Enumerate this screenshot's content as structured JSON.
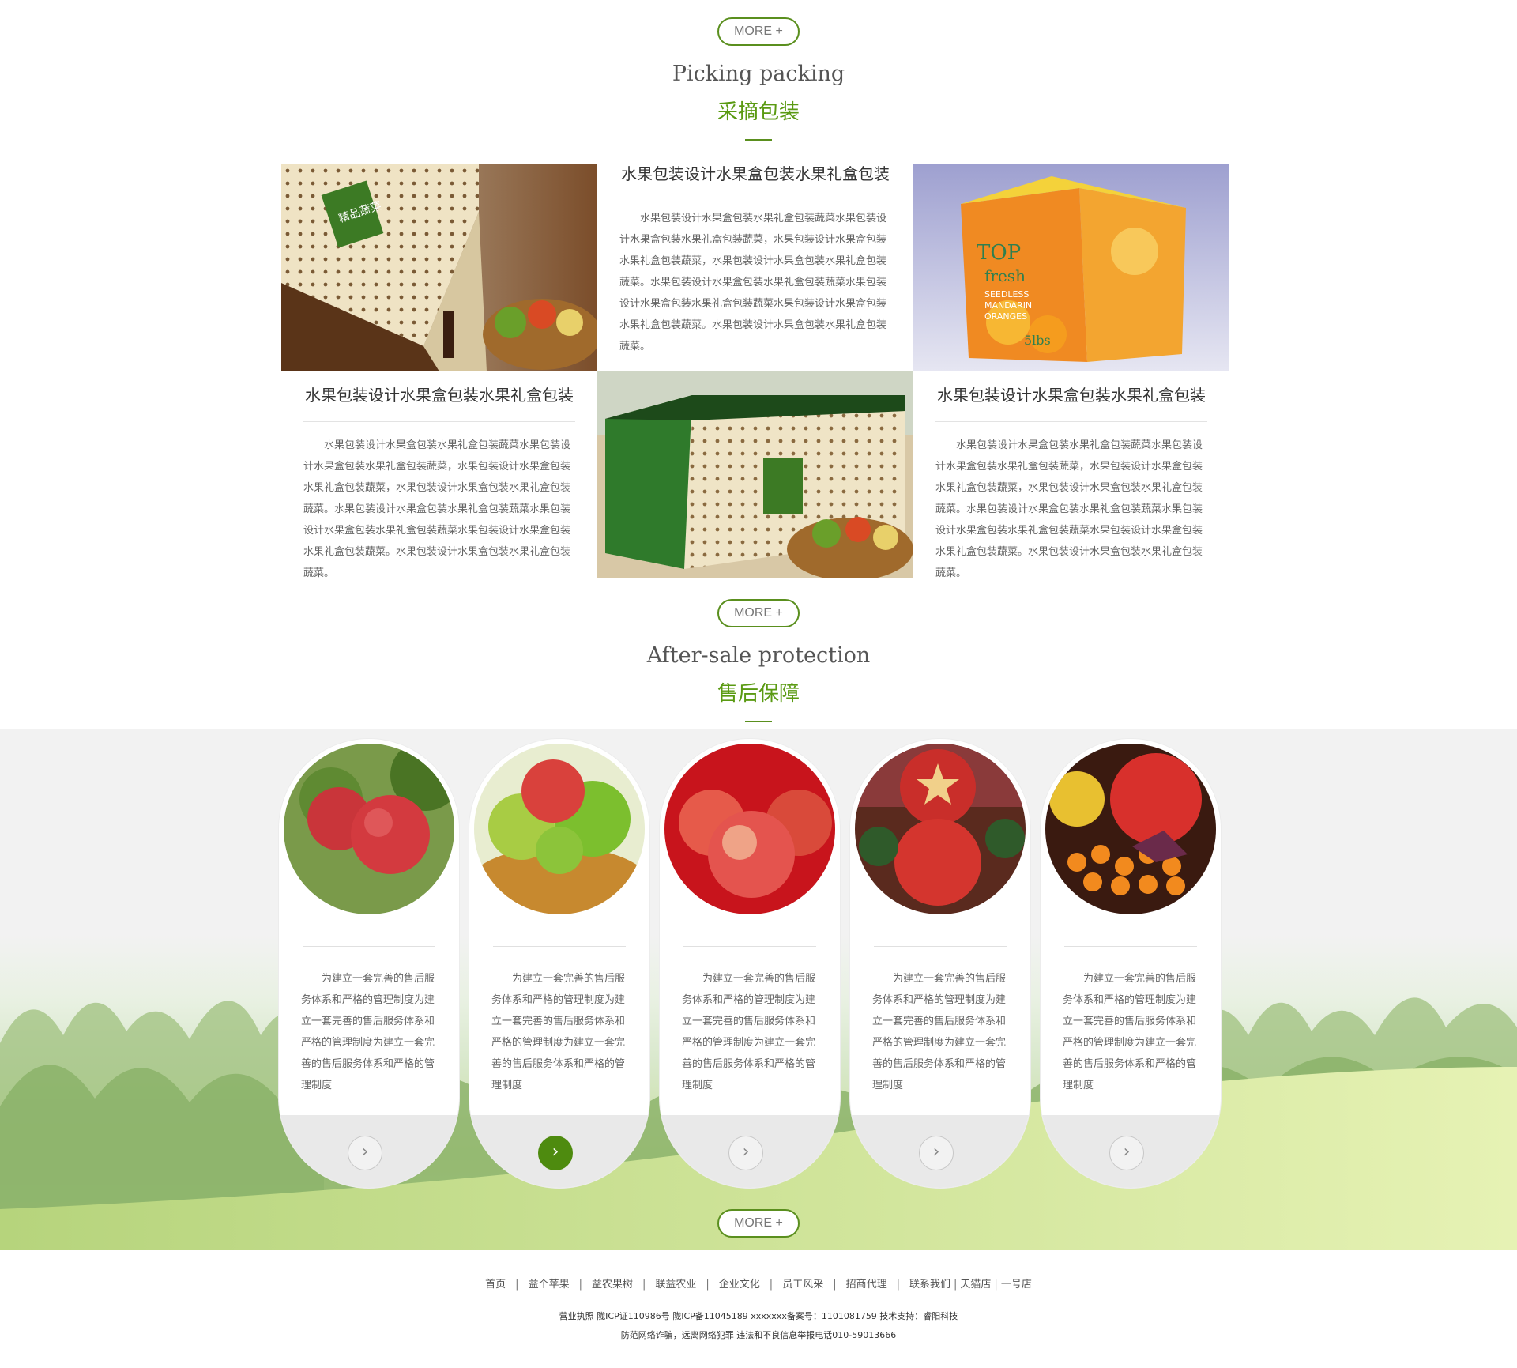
{
  "more_label": "MORE +",
  "picking": {
    "title_en": "Picking packing",
    "title_cn": "采摘包装",
    "items": [
      {
        "title": "水果包装设计水果盒包装水果礼盒包装",
        "body": "水果包装设计水果盒包装水果礼盒包装蔬菜水果包装设计水果盒包装水果礼盒包装蔬菜，水果包装设计水果盒包装水果礼盒包装蔬菜，水果包装设计水果盒包装水果礼盒包装蔬菜。水果包装设计水果盒包装水果礼盒包装蔬菜水果包装设计水果盒包装水果礼盒包装蔬菜水果包装设计水果盒包装水果礼盒包装蔬菜。水果包装设计水果盒包装水果礼盒包装蔬菜。"
      },
      {
        "title": "水果包装设计水果盒包装水果礼盒包装",
        "body": "水果包装设计水果盒包装水果礼盒包装蔬菜水果包装设计水果盒包装水果礼盒包装蔬菜，水果包装设计水果盒包装水果礼盒包装蔬菜，水果包装设计水果盒包装水果礼盒包装蔬菜。水果包装设计水果盒包装水果礼盒包装蔬菜水果包装设计水果盒包装水果礼盒包装蔬菜水果包装设计水果盒包装水果礼盒包装蔬菜。水果包装设计水果盒包装水果礼盒包装蔬菜。"
      },
      {
        "title": "水果包装设计水果盒包装水果礼盒包装",
        "body": "水果包装设计水果盒包装水果礼盒包装蔬菜水果包装设计水果盒包装水果礼盒包装蔬菜，水果包装设计水果盒包装水果礼盒包装蔬菜，水果包装设计水果盒包装水果礼盒包装蔬菜。水果包装设计水果盒包装水果礼盒包装蔬菜水果包装设计水果盒包装水果礼盒包装蔬菜水果包装设计水果盒包装水果礼盒包装蔬菜。水果包装设计水果盒包装水果礼盒包装蔬菜。"
      }
    ],
    "box_label_green": "精品蔬菜",
    "box_label_orange": [
      "TOP",
      "fresh",
      "SEEDLESS",
      "MANDARIN",
      "ORANGES",
      "5lbs"
    ]
  },
  "aftersale": {
    "title_en": "After-sale protection",
    "title_cn": "售后保障",
    "cards": [
      {
        "body": "为建立一套完善的售后服务体系和严格的管理制度为建立一套完善的售后服务体系和严格的管理制度为建立一套完善的售后服务体系和严格的管理制度"
      },
      {
        "body": "为建立一套完善的售后服务体系和严格的管理制度为建立一套完善的售后服务体系和严格的管理制度为建立一套完善的售后服务体系和严格的管理制度"
      },
      {
        "body": "为建立一套完善的售后服务体系和严格的管理制度为建立一套完善的售后服务体系和严格的管理制度为建立一套完善的售后服务体系和严格的管理制度"
      },
      {
        "body": "为建立一套完善的售后服务体系和严格的管理制度为建立一套完善的售后服务体系和严格的管理制度为建立一套完善的售后服务体系和严格的管理制度"
      },
      {
        "body": "为建立一套完善的售后服务体系和严格的管理制度为建立一套完善的售后服务体系和严格的管理制度为建立一套完善的售后服务体系和严格的管理制度"
      }
    ],
    "arrow_glyph": "›"
  },
  "footer": {
    "nav": [
      "首页",
      "益个苹果",
      "益农果树",
      "联益农业",
      "企业文化",
      "员工风采",
      "招商代理",
      "联系我们",
      "天猫店",
      "一号店"
    ],
    "line1": "营业执照  陇ICP证110986号   陇ICP备11045189   xxxxxxx备案号：1101081759   技术支持：睿阳科技",
    "line2": "防范网络诈骗，远离网络犯罪   违法和不良信息举报电话010-59013666"
  },
  "colors": {
    "accent": "#5a9a12",
    "button_active": "#4e8b0f"
  }
}
